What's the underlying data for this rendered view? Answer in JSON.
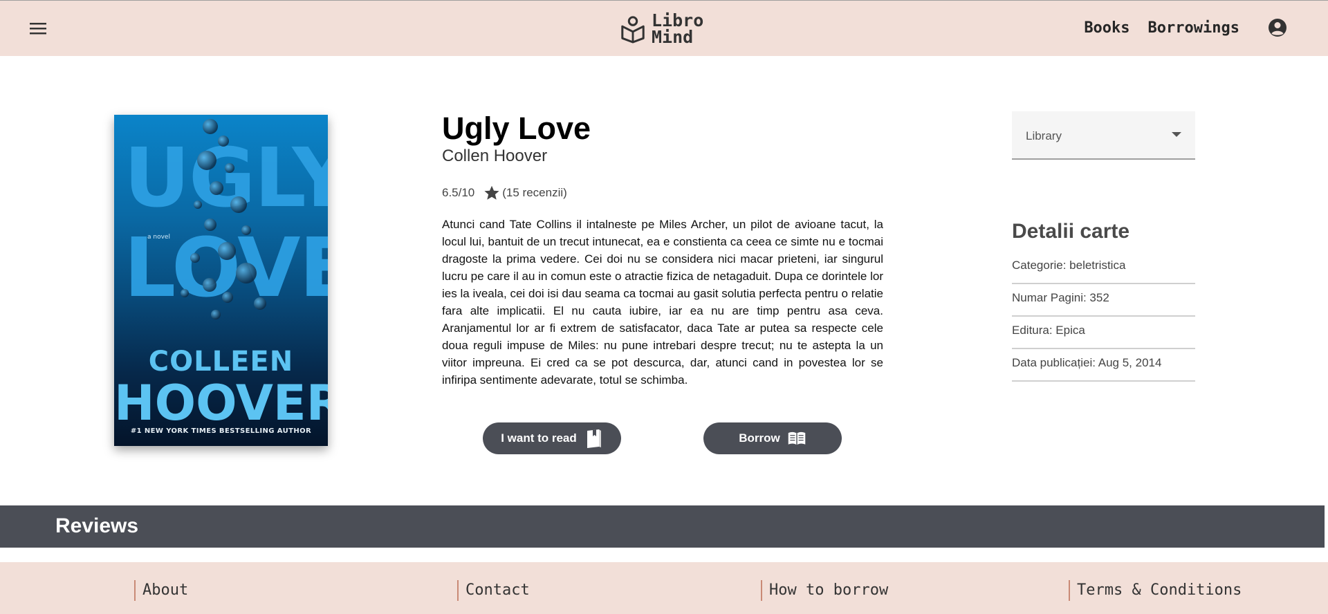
{
  "header": {
    "logo_line1": "Libro",
    "logo_line2": "Mind",
    "nav": [
      "Books",
      "Borrowings"
    ],
    "icons": [
      "menu-icon",
      "book-reader-logo-icon",
      "account-circle-icon"
    ]
  },
  "cover": {
    "title_line1": "UGLY",
    "title_line2": "LOVE",
    "novel": "a novel",
    "author_line1": "COLLEEN",
    "author_line2": "HOOVER",
    "tagline": "#1 NEW YORK TIMES BESTSELLING AUTHOR"
  },
  "book": {
    "title": "Ugly Love",
    "author": "Collen Hoover",
    "score": "6.5/10",
    "reviews_count": "(15 recenzii)",
    "description": "Atunci cand Tate Collins il intalneste pe Miles Archer, un pilot de avioane tacut, la locul lui, bantuit de un trecut intunecat, ea e constienta ca ceea ce simte nu e tocmai dragoste la prima vedere. Cei doi nu se considera nici macar prieteni, iar singurul lucru pe care il au in comun este o atractie fizica de netagaduit. Dupa ce dorintele lor ies la iveala, cei doi isi dau seama ca tocmai au gasit solutia perfecta pentru o relatie fara alte implicatii. El nu cauta iubire, iar ea nu are timp pentru asa ceva. Aranjamentul lor ar fi extrem de satisfacator, daca Tate ar putea sa respecte cele doua reguli impuse de Miles: nu pune intrebari despre trecut; nu te astepta la un viitor impreuna. Ei cred ca se pot descurca, dar, atunci cand in povestea lor se infiripa sentimente adevarate, totul se schimba."
  },
  "actions": {
    "want_to_read": "I want to read",
    "borrow": "Borrow"
  },
  "library_select": {
    "value": "Library"
  },
  "details": {
    "title": "Detalii carte",
    "rows": [
      "Categorie: beletristica",
      "Numar Pagini: 352",
      "Editura: Epica",
      "Data publicației: Aug 5, 2014"
    ]
  },
  "reviews": {
    "title": "Reviews"
  },
  "footer": {
    "links": [
      "About",
      "Contact",
      "How to borrow",
      "Terms & Conditions"
    ]
  },
  "colors": {
    "header_bg": "#f2dfd8",
    "dark_band": "#4b4e56",
    "footer_bg": "#f2dfd8",
    "accent_divider": "#c98a76"
  }
}
